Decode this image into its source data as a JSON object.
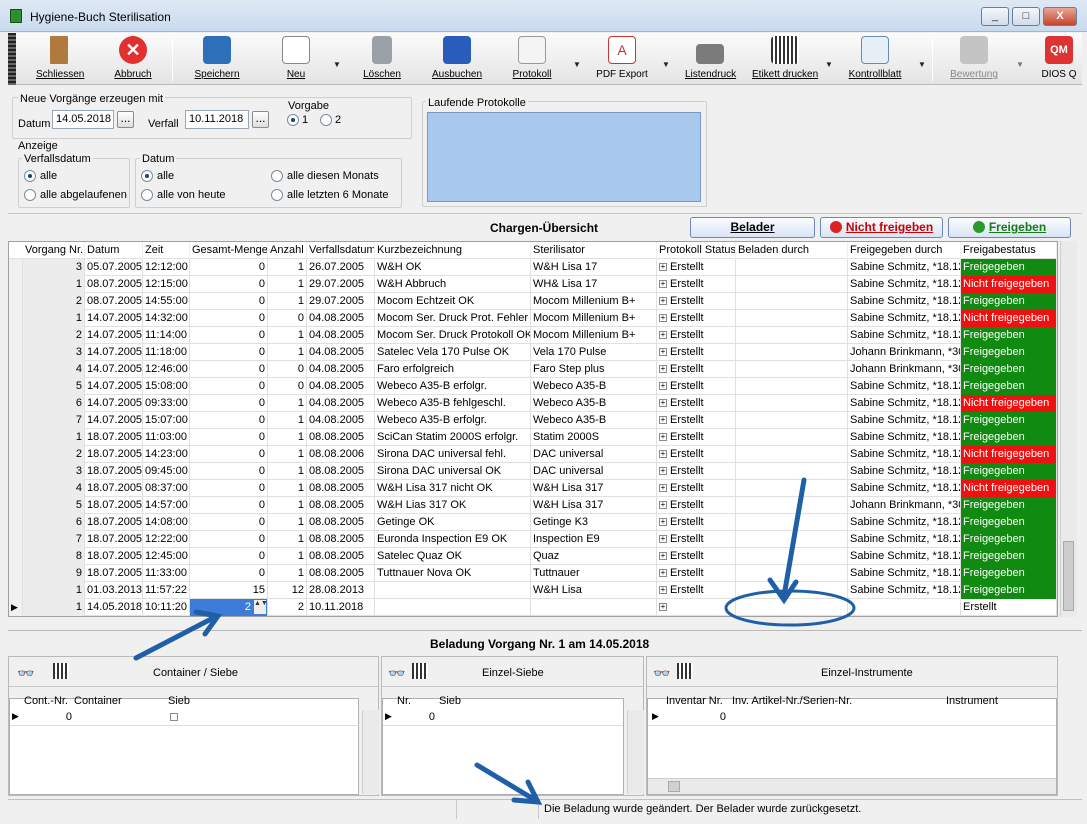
{
  "window": {
    "title": "Hygiene-Buch Sterilisation",
    "btn_min": "_",
    "btn_max": "□",
    "btn_close": "X"
  },
  "toolbar": {
    "schliessen": "Schliessen",
    "abbruch": "Abbruch",
    "speichern": "Speichern",
    "neu": "Neu",
    "loeschen": "Löschen",
    "ausbuchen": "Ausbuchen",
    "protokoll": "Protokoll",
    "pdf_export": "PDF Export",
    "listendruck": "Listendruck",
    "etikett": "Etikett drucken",
    "kontrollblatt": "Kontrollblatt",
    "bewertung": "Bewertung",
    "dios": "DIOS Q",
    "drop": "▼"
  },
  "form": {
    "group_title": "Neue Vorgänge erzeugen mit",
    "datum_label": "Datum",
    "datum_value": "14.05.2018",
    "verfall_label": "Verfall",
    "verfall_value": "10.11.2018",
    "dots": "...",
    "vorgabe_label": "Vorgabe",
    "vorgabe_1": "1",
    "vorgabe_2": "2",
    "anzeige_label": "Anzeige",
    "verfallsdatum_label": "Verfallsdatum",
    "alle": "alle",
    "alle_abgelaufenen": "alle abgelaufenen",
    "datum_group": "Datum",
    "datum_alle": "alle",
    "alle_von_heute": "alle von heute",
    "alle_diesen_monats": "alle diesen Monats",
    "alle_letzten_6": "alle letzten 6 Monate",
    "laufende": "Laufende Protokolle"
  },
  "overview": {
    "title": "Chargen-Übersicht",
    "belader_btn": "Belader",
    "nicht_btn": "Nicht freigeben",
    "frei_btn": "Freigeben"
  },
  "columns": [
    "Vorgang Nr.",
    "Datum",
    "Zeit",
    "Gesamt-Menge",
    "Anzahl",
    "Verfallsdatum",
    "Kurzbezeichnung",
    "Sterilisator",
    "Protokoll Status",
    "Beladen durch",
    "Freigegeben durch",
    "Freigabestatus"
  ],
  "rows": [
    [
      "3",
      "05.07.2005",
      "12:12:00",
      "0",
      "1",
      "26.07.2005",
      "W&H OK",
      "W&H Lisa 17",
      "Erstellt",
      "",
      "Sabine Schmitz, *18.12",
      "Freigegeben"
    ],
    [
      "1",
      "08.07.2005",
      "12:15:00",
      "0",
      "1",
      "29.07.2005",
      "W&H Abbruch",
      "WH& Lisa 17",
      "Erstellt",
      "",
      "Sabine Schmitz, *18.12",
      "Nicht freigegeben"
    ],
    [
      "2",
      "08.07.2005",
      "14:55:00",
      "0",
      "1",
      "29.07.2005",
      "Mocom Echtzeit OK",
      "Mocom Millenium B+",
      "Erstellt",
      "",
      "Sabine Schmitz, *18.12",
      "Freigegeben"
    ],
    [
      "1",
      "14.07.2005",
      "14:32:00",
      "0",
      "0",
      "04.08.2005",
      "Mocom Ser. Druck Prot. Fehler",
      "Mocom Millenium B+",
      "Erstellt",
      "",
      "Sabine Schmitz, *18.12",
      "Nicht freigegeben"
    ],
    [
      "2",
      "14.07.2005",
      "11:14:00",
      "0",
      "1",
      "04.08.2005",
      "Mocom Ser. Druck Protokoll OK",
      "Mocom Millenium B+",
      "Erstellt",
      "",
      "Sabine Schmitz, *18.12",
      "Freigegeben"
    ],
    [
      "3",
      "14.07.2005",
      "11:18:00",
      "0",
      "1",
      "04.08.2005",
      "Satelec Vela 170 Pulse OK",
      "Vela 170 Pulse",
      "Erstellt",
      "",
      "Johann Brinkmann, *30",
      "Freigegeben"
    ],
    [
      "4",
      "14.07.2005",
      "12:46:00",
      "0",
      "0",
      "04.08.2005",
      "Faro erfolgreich",
      "Faro Step plus",
      "Erstellt",
      "",
      "Johann Brinkmann, *30",
      "Freigegeben"
    ],
    [
      "5",
      "14.07.2005",
      "15:08:00",
      "0",
      "0",
      "04.08.2005",
      "Webeco A35-B erfolgr.",
      "Webeco A35-B",
      "Erstellt",
      "",
      "Sabine Schmitz, *18.12",
      "Freigegeben"
    ],
    [
      "6",
      "14.07.2005",
      "09:33:00",
      "0",
      "1",
      "04.08.2005",
      "Webeco A35-B fehlgeschl.",
      "Webeco A35-B",
      "Erstellt",
      "",
      "Sabine Schmitz, *18.12",
      "Nicht freigegeben"
    ],
    [
      "7",
      "14.07.2005",
      "15:07:00",
      "0",
      "1",
      "04.08.2005",
      "Webeco A35-B erfolgr.",
      "Webeco A35-B",
      "Erstellt",
      "",
      "Sabine Schmitz, *18.12",
      "Freigegeben"
    ],
    [
      "1",
      "18.07.2005",
      "11:03:00",
      "0",
      "1",
      "08.08.2005",
      "SciCan Statim 2000S erfolgr.",
      "Statim 2000S",
      "Erstellt",
      "",
      "Sabine Schmitz, *18.12",
      "Freigegeben"
    ],
    [
      "2",
      "18.07.2005",
      "14:23:00",
      "0",
      "1",
      "08.08.2006",
      "Sirona DAC universal fehl.",
      "DAC universal",
      "Erstellt",
      "",
      "Sabine Schmitz, *18.12",
      "Nicht freigegeben"
    ],
    [
      "3",
      "18.07.2005",
      "09:45:00",
      "0",
      "1",
      "08.08.2005",
      "Sirona DAC universal OK",
      "DAC universal",
      "Erstellt",
      "",
      "Sabine Schmitz, *18.12",
      "Freigegeben"
    ],
    [
      "4",
      "18.07.2005",
      "08:37:00",
      "0",
      "1",
      "08.08.2005",
      "W&H Lisa 317 nicht OK",
      "W&H Lisa 317",
      "Erstellt",
      "",
      "Sabine Schmitz, *18.12",
      "Nicht freigegeben"
    ],
    [
      "5",
      "18.07.2005",
      "14:57:00",
      "0",
      "1",
      "08.08.2005",
      "W&H Lias 317 OK",
      "W&H Lisa 317",
      "Erstellt",
      "",
      "Johann Brinkmann, *30",
      "Freigegeben"
    ],
    [
      "6",
      "18.07.2005",
      "14:08:00",
      "0",
      "1",
      "08.08.2005",
      "Getinge OK",
      "Getinge K3",
      "Erstellt",
      "",
      "Sabine Schmitz, *18.12",
      "Freigegeben"
    ],
    [
      "7",
      "18.07.2005",
      "12:22:00",
      "0",
      "1",
      "08.08.2005",
      "Euronda Inspection E9 OK",
      "Inspection E9",
      "Erstellt",
      "",
      "Sabine Schmitz, *18.12",
      "Freigegeben"
    ],
    [
      "8",
      "18.07.2005",
      "12:45:00",
      "0",
      "1",
      "08.08.2005",
      "Satelec Quaz OK",
      "Quaz",
      "Erstellt",
      "",
      "Sabine Schmitz, *18.12",
      "Freigegeben"
    ],
    [
      "9",
      "18.07.2005",
      "11:33:00",
      "0",
      "1",
      "08.08.2005",
      "Tuttnauer Nova OK",
      "Tuttnauer",
      "Erstellt",
      "",
      "Sabine Schmitz, *18.12",
      "Freigegeben"
    ],
    [
      "1",
      "01.03.2013",
      "11:57:22",
      "15",
      "12",
      "28.08.2013",
      "",
      "W&H Lisa",
      "Erstellt",
      "",
      "Sabine Schmitz, *18.12",
      "Freigegeben"
    ],
    [
      "1",
      "14.05.2018",
      "10:11:20",
      "2",
      "2",
      "10.11.2018",
      "",
      "",
      "",
      "",
      "",
      "Erstellt"
    ]
  ],
  "beladung": {
    "title": "Beladung Vorgang Nr. 1 am 14.05.2018",
    "container_title": "Container / Siebe",
    "einzel_siebe_title": "Einzel-Siebe",
    "einzel_instr_title": "Einzel-Instrumente",
    "c_cols": [
      "Cont.-Nr.",
      "Container",
      "Sieb"
    ],
    "c_row": "0",
    "s_cols": [
      "Nr.",
      "Sieb"
    ],
    "s_row": "0",
    "i_cols": [
      "Inventar Nr.",
      "Inv. Artikel-Nr./Serien-Nr.",
      "Instrument"
    ],
    "i_row": "0"
  },
  "status": {
    "message": "Die Beladung wurde geändert. Der Belader wurde zurückgesetzt."
  },
  "colors": {
    "green": "#118a11",
    "red": "#ee1111",
    "annotation": "#1e5fa8"
  }
}
